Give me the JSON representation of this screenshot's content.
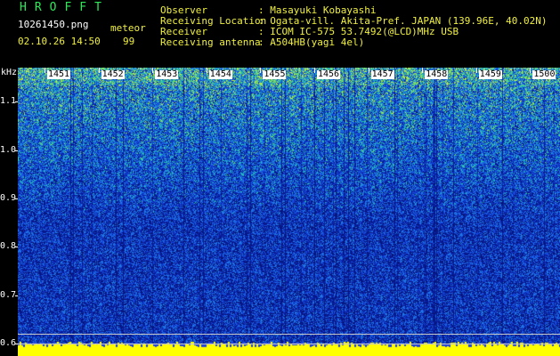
{
  "header": {
    "logo": "HROFFT",
    "filename": "10261450.png",
    "mode": "meteor",
    "datetime": "02.10.26 14:50",
    "count": "99",
    "info": [
      {
        "label": "Observer",
        "value": ": Masayuki Kobayashi"
      },
      {
        "label": "Receiving Location",
        "value": ": Ogata-vill. Akita-Pref. JAPAN (139.96E, 40.02N)"
      },
      {
        "label": "Receiver",
        "value": ": ICOM IC-575 53.7492(@LCD)MHz USB"
      },
      {
        "label": "Receiving antenna",
        "value": ": A504HB(yagi 4el)"
      }
    ]
  },
  "chart_data": {
    "type": "heatmap",
    "ylabel": "kHz",
    "yticks": [
      "1.1",
      "1.0",
      "0.9",
      "0.8",
      "0.7",
      "0.6"
    ],
    "ytick_values": [
      1.1,
      1.0,
      0.9,
      0.8,
      0.7,
      0.6
    ],
    "ylim": [
      0.575,
      1.17
    ],
    "xticks": [
      "1451",
      "1452",
      "1453",
      "1454",
      "1455",
      "1456",
      "1457",
      "1458",
      "1459",
      "1500"
    ],
    "reference_lines_khz": [
      0.62,
      0.6
    ],
    "colors": {
      "low": "#0a1ea0",
      "mid": "#1e5ae6",
      "high": "#22c8b4",
      "peak": "#c8f03c",
      "bottom_band": "#ffff00"
    }
  }
}
